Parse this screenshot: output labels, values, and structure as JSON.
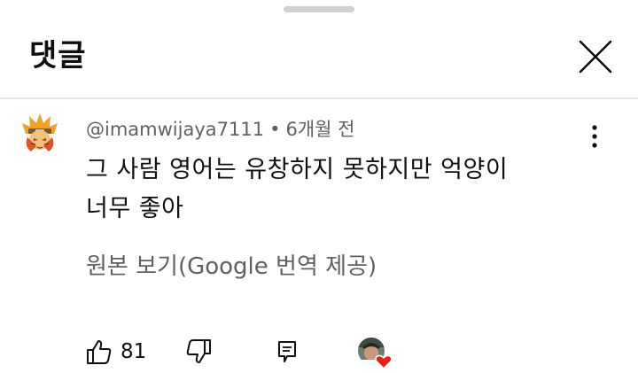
{
  "sheet": {
    "title": "댓글"
  },
  "comment": {
    "author": "@imamwijaya7111",
    "separator": "•",
    "time": "6개월 전",
    "text": "그 사람 영어는 유창하지 못하지만 억양이\n너무 좋아",
    "see_original": "원본 보기(Google 번역 제공)",
    "like_count": "81",
    "avatar_icon": "ninja-cartoon-avatar",
    "hearted_badge_icon": "creator-heart-avatar"
  },
  "colors": {
    "text_primary": "#0f0f0f",
    "text_secondary": "#606060",
    "divider": "#e5e5e5",
    "heart": "#e62117"
  }
}
